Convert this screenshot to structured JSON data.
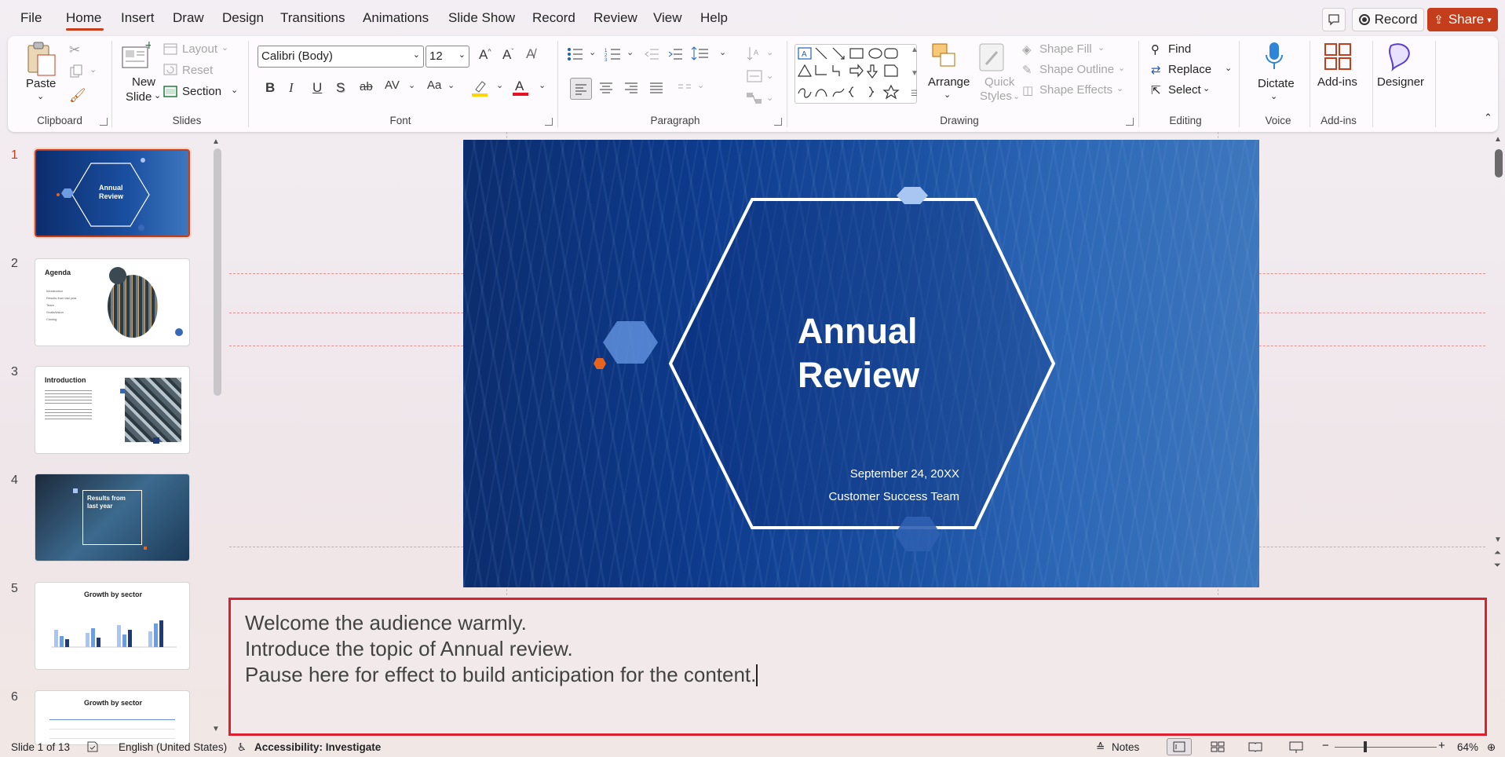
{
  "menu": {
    "items": [
      "File",
      "Home",
      "Insert",
      "Draw",
      "Design",
      "Transitions",
      "Animations",
      "Slide Show",
      "Record",
      "Review",
      "View",
      "Help"
    ],
    "active": "Home",
    "record_label": "Record",
    "share_label": "Share"
  },
  "ribbon": {
    "clipboard": {
      "paste": "Paste",
      "label": "Clipboard"
    },
    "slides": {
      "new_slide_l1": "New",
      "new_slide_l2": "Slide",
      "layout": "Layout",
      "reset": "Reset",
      "section": "Section",
      "label": "Slides"
    },
    "font": {
      "family": "Calibri (Body)",
      "size": "12",
      "label": "Font"
    },
    "paragraph": {
      "label": "Paragraph"
    },
    "drawing": {
      "arrange": "Arrange",
      "quick_l1": "Quick",
      "quick_l2": "Styles",
      "shape_fill": "Shape Fill",
      "shape_outline": "Shape Outline",
      "shape_effects": "Shape Effects",
      "label": "Drawing"
    },
    "editing": {
      "find": "Find",
      "replace": "Replace",
      "select": "Select",
      "label": "Editing"
    },
    "voice": {
      "dictate": "Dictate",
      "label": "Voice"
    },
    "addins": {
      "addins": "Add-ins",
      "label": "Add-ins"
    },
    "designer": {
      "label": "Designer"
    }
  },
  "thumbnails": {
    "numbers": [
      "1",
      "2",
      "3",
      "4",
      "5",
      "6"
    ],
    "t1": {
      "title_l1": "Annual",
      "title_l2": "Review"
    },
    "t2": {
      "title": "Agenda",
      "items": [
        "Introduction",
        "Results from last year",
        "Team",
        "Goals/vision",
        "Closing"
      ]
    },
    "t3": {
      "title": "Introduction"
    },
    "t4": {
      "title_l1": "Results from",
      "title_l2": "last year"
    },
    "t5": {
      "title": "Growth by sector"
    },
    "t6": {
      "title": "Growth by sector"
    }
  },
  "slide": {
    "title_l1": "Annual",
    "title_l2": "Review",
    "date": "September 24, 20XX",
    "team": "Customer Success Team"
  },
  "notes": {
    "lines": [
      "Welcome the audience warmly.",
      "Introduce the topic of Annual review.",
      "Pause here for effect to build anticipation for the content."
    ]
  },
  "status": {
    "slide_info": "Slide 1 of 13",
    "language": "English (United States)",
    "accessibility": "Accessibility: Investigate",
    "notes": "Notes",
    "zoom": "64%"
  },
  "colors": {
    "accent": "#c43e1c",
    "notes_border": "#dc2030",
    "slide_blue": "#0d3a8c",
    "orange": "#e8641e"
  }
}
